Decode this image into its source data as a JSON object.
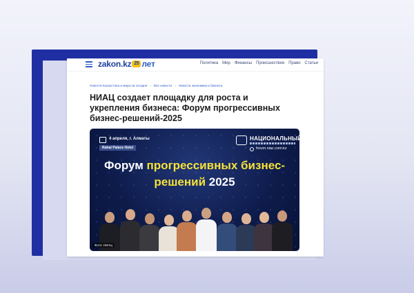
{
  "site": {
    "logo_main": "zakon.kz",
    "logo_badge": "25",
    "logo_suffix": "лет",
    "nav": [
      "Политика",
      "Мир",
      "Финансы",
      "Происшествия",
      "Право",
      "Статьи"
    ]
  },
  "breadcrumbs": [
    "Новости Казахстана и мира на сегодня",
    "Все новости",
    "Новости экономики и бизнеса"
  ],
  "article": {
    "title": "НИАЦ создает площадку для роста и укрепления бизнеса: Форум прогрессивных бизнес-решений-2025"
  },
  "banner": {
    "date_location": "4 апреля, г. Алматы",
    "venue": "Rahat Palace Hotel",
    "org_name": "НАЦИОНАЛЬНЫЙ",
    "website": "forum.niac.com.kz",
    "headline_white_1": "Форум ",
    "headline_yellow": "прогрессивных бизнес-решений",
    "headline_white_2": " 2025",
    "photo_credit": "Фото: НИАЦ"
  },
  "colors": {
    "frame": "#1f2fa3",
    "link": "#2c5cc5",
    "headline_accent": "#f5e13a",
    "banner_bg": "#0e1c4c"
  }
}
